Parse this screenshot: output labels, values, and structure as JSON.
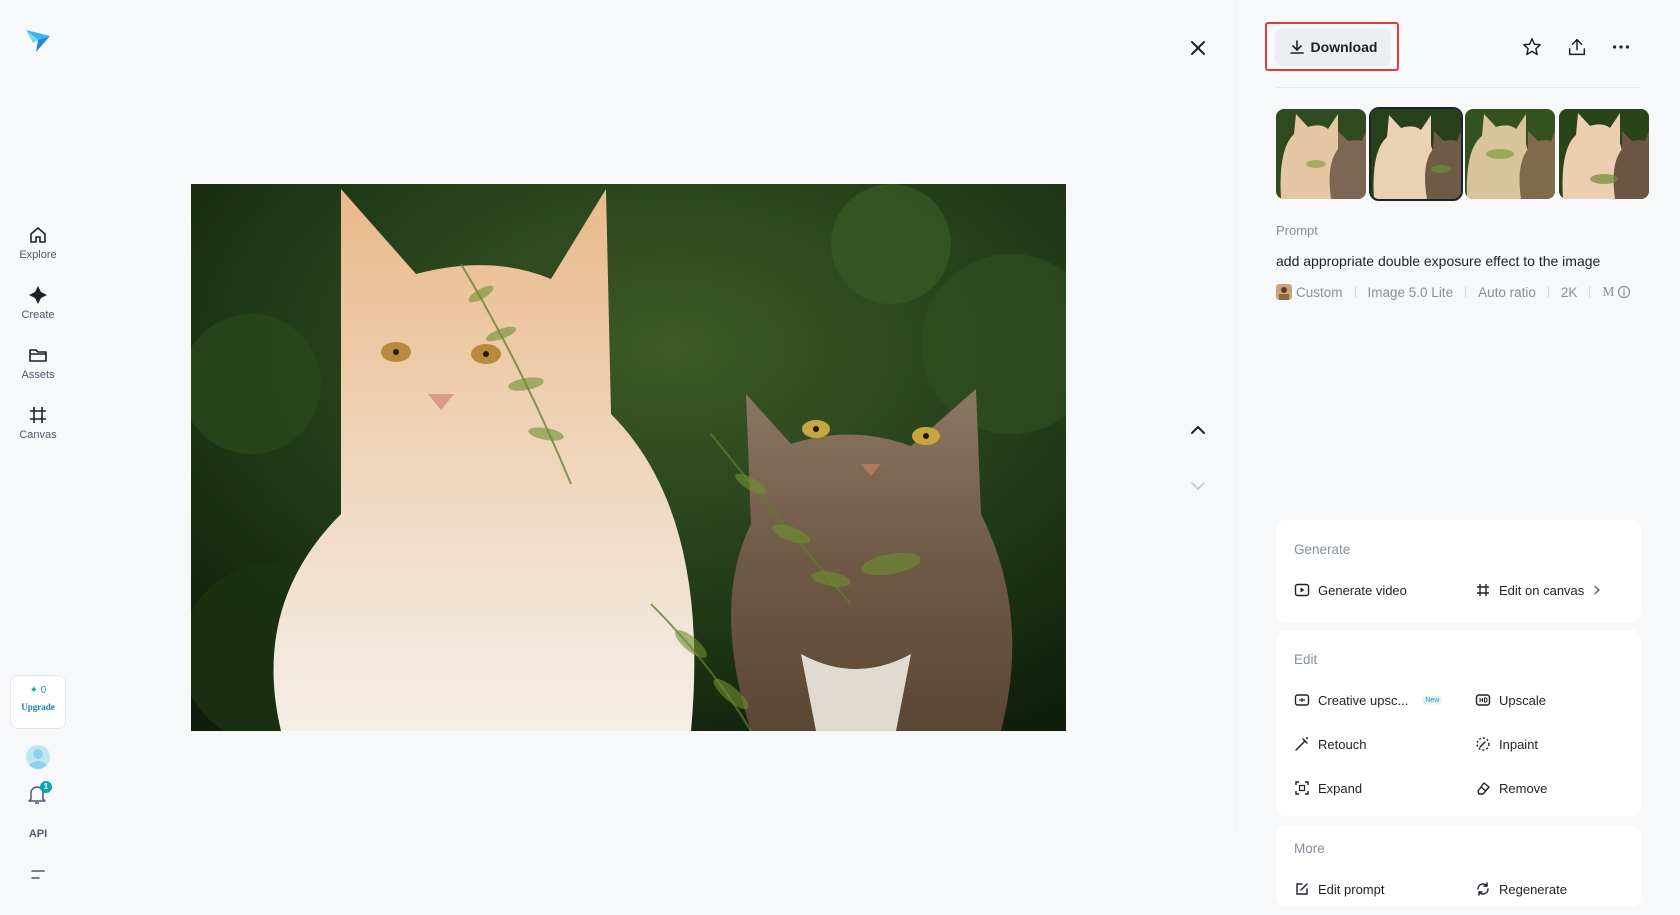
{
  "sidebar": {
    "items": [
      {
        "label": "Explore",
        "icon": "home-icon"
      },
      {
        "label": "Create",
        "icon": "sparkle-icon"
      },
      {
        "label": "Assets",
        "icon": "folder-icon"
      },
      {
        "label": "Canvas",
        "icon": "canvas-icon"
      }
    ],
    "upgrade": {
      "credits": "0",
      "label": "Upgrade"
    },
    "notifications_count": "1",
    "api_label": "API"
  },
  "toolbar": {
    "download_label": "Download"
  },
  "details": {
    "prompt_label": "Prompt",
    "prompt_text": "add appropriate double exposure effect to the image",
    "meta": {
      "style": "Custom",
      "model": "Image 5.0 Lite",
      "ratio": "Auto ratio",
      "resolution": "2K",
      "mode": "M"
    }
  },
  "cards": {
    "generate": {
      "title": "Generate",
      "generate_video": "Generate video",
      "edit_on_canvas": "Edit on canvas"
    },
    "edit": {
      "title": "Edit",
      "creative_upscale": "Creative upsc...",
      "new_badge": "New",
      "upscale": "Upscale",
      "retouch": "Retouch",
      "inpaint": "Inpaint",
      "expand": "Expand",
      "remove": "Remove"
    },
    "more": {
      "title": "More",
      "edit_prompt": "Edit prompt",
      "regenerate": "Regenerate"
    }
  },
  "colors": {
    "accent": "#0fa3b1",
    "highlight_border": "#e53935",
    "background": "#f7f8fa"
  }
}
